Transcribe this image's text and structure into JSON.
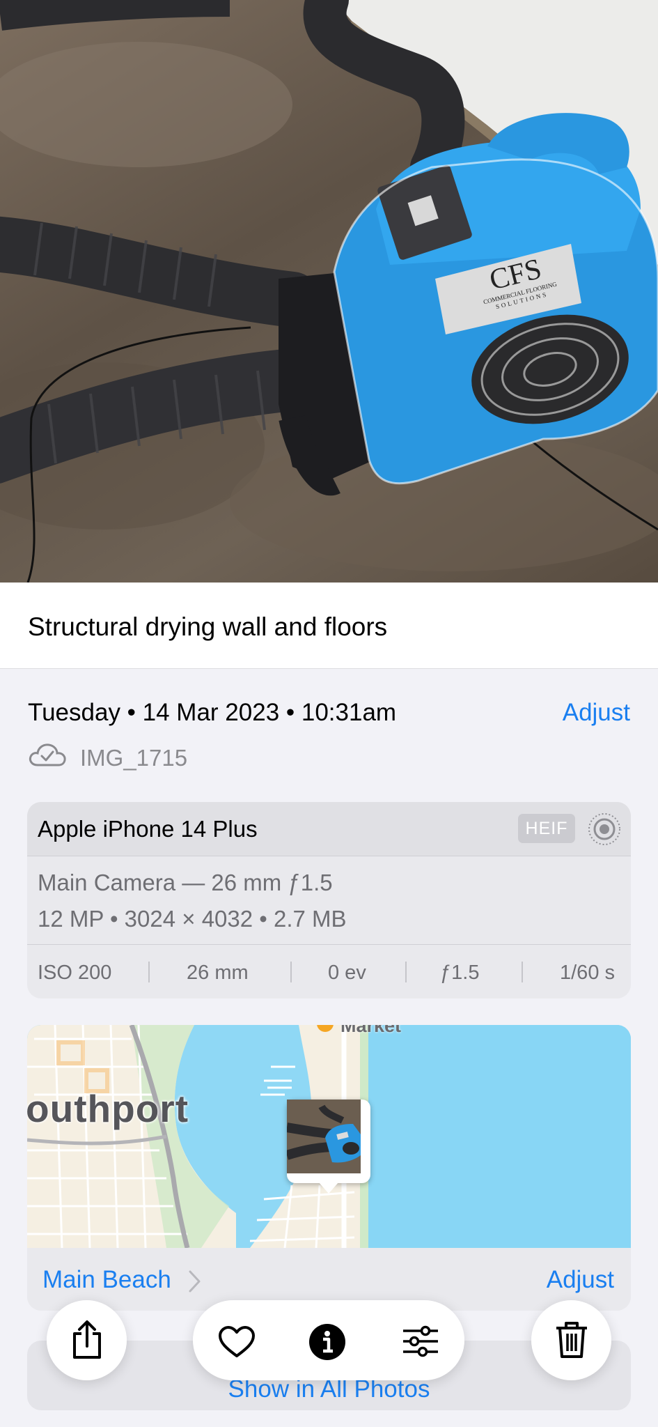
{
  "caption": "Structural drying wall and floors",
  "date": {
    "text": "Tuesday • 14 Mar 2023 • 10:31am",
    "adjust_label": "Adjust"
  },
  "file": {
    "icon": "icloud-check-icon",
    "name": "IMG_1715"
  },
  "camera": {
    "model": "Apple iPhone 14 Plus",
    "format_badge": "HEIF",
    "live_icon": "live-photo-icon",
    "lens": "Main Camera — 26 mm ƒ1.5",
    "specs": "12 MP • 3024 × 4032 • 2.7 MB",
    "exif": {
      "iso": "ISO 200",
      "focal": "26 mm",
      "ev": "0 ev",
      "aperture": "ƒ1.5",
      "shutter": "1/60 s"
    }
  },
  "map": {
    "place_label": "outhport",
    "poi_label": "Market",
    "location_name": "Main Beach",
    "adjust_label": "Adjust"
  },
  "show_all_label": "Show in All Photos",
  "photo": {
    "brand_text": "CFS",
    "brand_line1": "COMMERCIAL FLOORING",
    "brand_line2": "SOLUTIONS"
  },
  "toolbar": {
    "share_icon": "share-icon",
    "favorite_icon": "heart-icon",
    "info_icon": "info-icon",
    "adjust_icon": "sliders-icon",
    "delete_icon": "trash-icon"
  },
  "colors": {
    "accent": "#1a7ff0",
    "background": "#f2f2f7",
    "secondary_text": "#6e6e73"
  }
}
